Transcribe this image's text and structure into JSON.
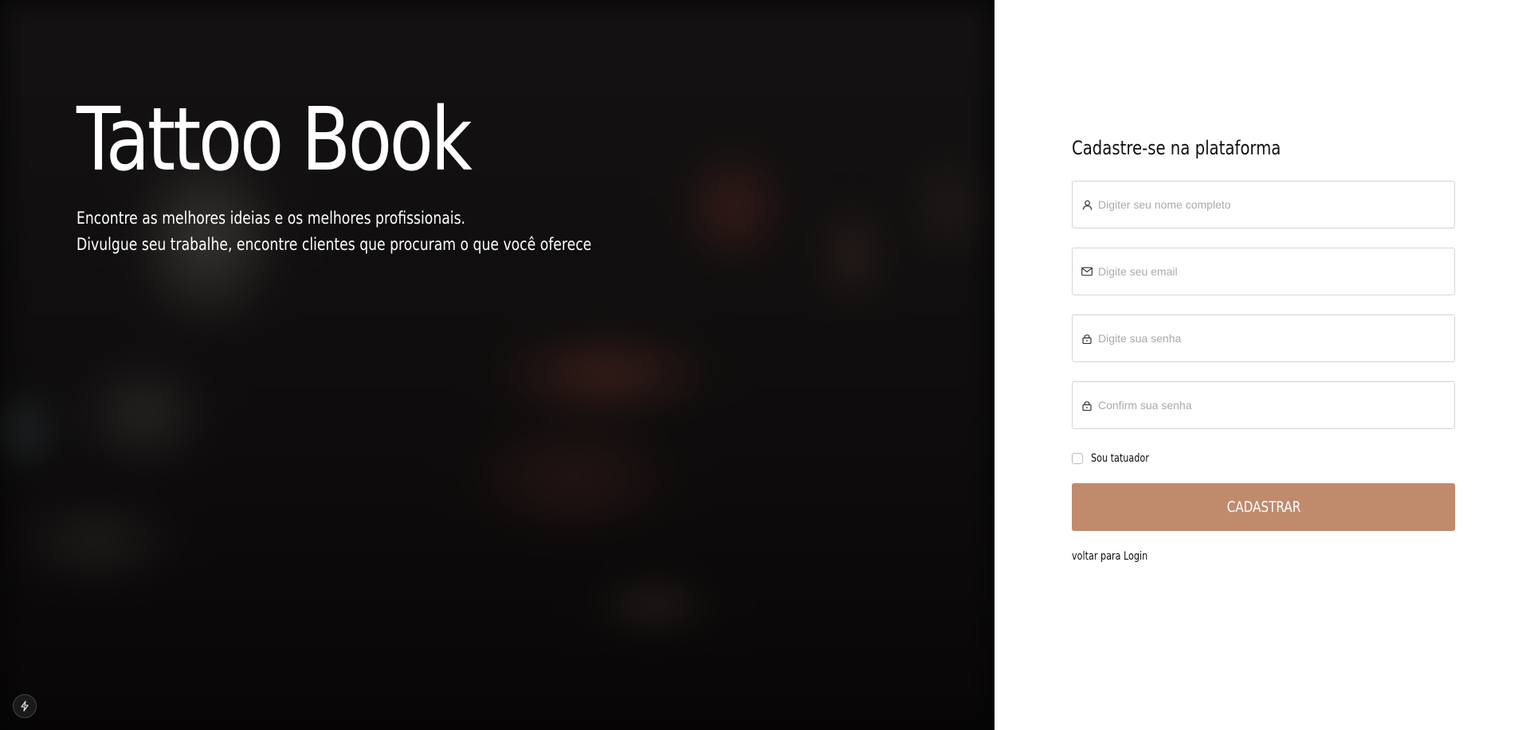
{
  "hero": {
    "title": "Tattoo Book",
    "subtitle_line1": "Encontre as melhores ideias e os melhores profissionais.",
    "subtitle_line2": "Divulgue seu trabalhe, encontre clientes que procuram o que você oferece"
  },
  "form": {
    "title": "Cadastre-se na plataforma",
    "fields": [
      {
        "icon": "user-icon",
        "placeholder": "Digiter seu nome completo",
        "value": ""
      },
      {
        "icon": "mail-icon",
        "placeholder": "Digite seu email",
        "value": ""
      },
      {
        "icon": "lock-icon",
        "placeholder": "Digite sua senha",
        "value": ""
      },
      {
        "icon": "lock-icon",
        "placeholder": "Confirm sua senha",
        "value": ""
      }
    ],
    "checkbox_label": "Sou tatuador",
    "checkbox_checked": false,
    "submit_label": "CADASTRAR",
    "back_link": "voltar para Login"
  },
  "colors": {
    "accent": "#c08a6d",
    "hero_background": "#050404",
    "panel_background": "#ffffff"
  },
  "badge_icon": "lightning-icon"
}
